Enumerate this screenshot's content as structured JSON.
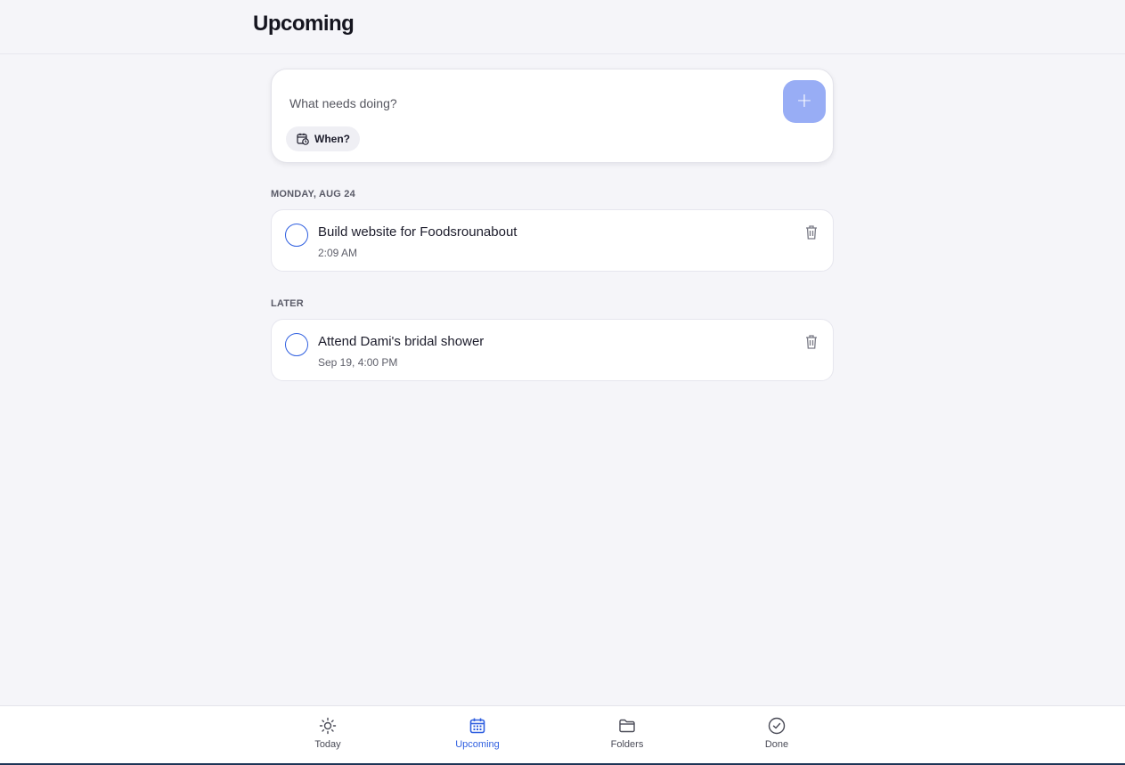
{
  "header": {
    "title": "Upcoming"
  },
  "composer": {
    "placeholder": "What needs doing?",
    "add_label": "+",
    "when_label": "When?",
    "add_color": "#98adf5"
  },
  "sections": [
    {
      "label": "MONDAY, AUG 24",
      "tasks": [
        {
          "title": "Build website for Foodsrounabout",
          "time": "2:09 AM"
        }
      ]
    },
    {
      "label": "LATER",
      "tasks": [
        {
          "title": "Attend Dami's bridal shower",
          "time": "Sep 19, 4:00 PM"
        }
      ]
    }
  ],
  "nav": {
    "items": [
      {
        "label": "Today",
        "icon": "sun-icon",
        "active": false
      },
      {
        "label": "Upcoming",
        "icon": "calendar-icon",
        "active": true
      },
      {
        "label": "Folders",
        "icon": "folder-icon",
        "active": false
      },
      {
        "label": "Done",
        "icon": "check-circle-icon",
        "active": false
      }
    ]
  },
  "colors": {
    "accent": "#2f5fe0",
    "background": "#f5f5f9"
  }
}
